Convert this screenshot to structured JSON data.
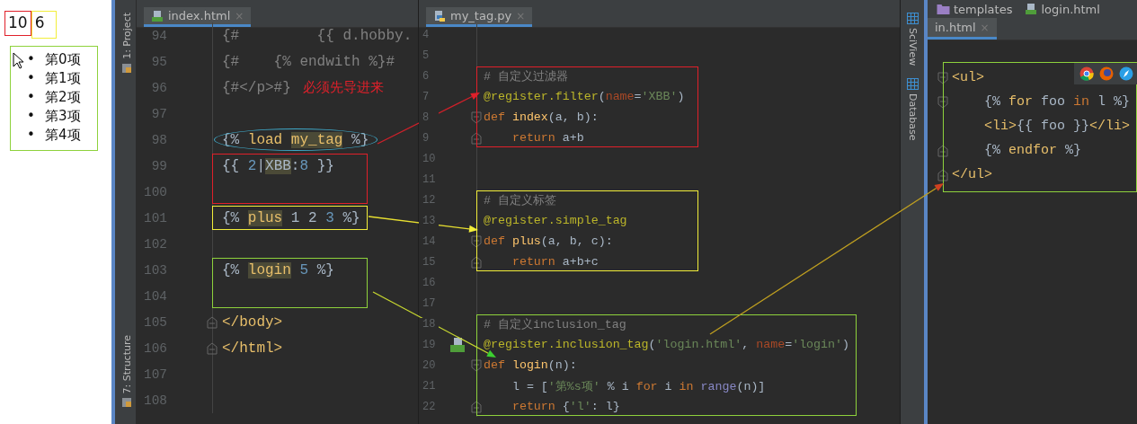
{
  "preview": {
    "numbers": [
      {
        "text": "10",
        "color": "#e0202a"
      },
      {
        "text": "6",
        "color": "#f2ee3a"
      }
    ],
    "list": {
      "color": "#8ed23c",
      "items": [
        {
          "bullet": "•",
          "text": "第0项"
        },
        {
          "bullet": "•",
          "text": "第1项"
        },
        {
          "bullet": "•",
          "text": "第2项"
        },
        {
          "bullet": "•",
          "text": "第3项"
        },
        {
          "bullet": "•",
          "text": "第4项"
        }
      ]
    }
  },
  "left_toolbar": [
    {
      "label": "1: Project"
    },
    {
      "label": "7: Structure"
    }
  ],
  "editors": [
    {
      "tab": {
        "label": "index.html",
        "close": "×",
        "selected": true,
        "kind": "html"
      },
      "blocks": [
        {
          "lines": [
            {
              "number": "94",
              "kind": "plain",
              "tokens": [
                {
                  "text": "{#         {{ d.hobby.",
                  "kind": "comment"
                }
              ]
            },
            {
              "number": "95",
              "kind": "plain",
              "tokens": [
                {
                  "text": "{#    {% endwith %}#",
                  "kind": "comment"
                }
              ]
            },
            {
              "number": "96",
              "kind": "plain",
              "tokens": [
                {
                  "text": "{#</p>#}",
                  "kind": "comment"
                }
              ],
              "note": "必须先导进来"
            },
            {
              "number": "97",
              "kind": "plain"
            }
          ]
        },
        {
          "frame": {
            "kind": "ellipse",
            "color": "#3fa9c9"
          },
          "lines": [
            {
              "number": "98",
              "kind": "plain",
              "tokens": [
                {
                  "text": "{% ",
                  "kind": "plain"
                },
                {
                  "text": "load ",
                  "kind": "directive"
                },
                {
                  "text": "my_tag",
                  "kind": "directive",
                  "highlight": true
                },
                {
                  "text": " %}",
                  "kind": "plain"
                }
              ]
            }
          ]
        },
        {
          "frame": {
            "kind": "rect",
            "color": "#e0202a"
          },
          "lines": [
            {
              "number": "99",
              "kind": "plain",
              "tokens": [
                {
                  "text": "{{ ",
                  "kind": "plain"
                },
                {
                  "text": "2",
                  "kind": "number"
                },
                {
                  "text": "|",
                  "kind": "plain"
                },
                {
                  "text": "XBB",
                  "kind": "plain",
                  "highlight": true
                },
                {
                  "text": ":",
                  "kind": "plain"
                },
                {
                  "text": "8",
                  "kind": "number"
                },
                {
                  "text": " }}",
                  "kind": "plain"
                }
              ]
            },
            {
              "number": "100",
              "kind": "plain"
            }
          ]
        },
        {
          "frame": {
            "kind": "rect",
            "color": "#f2ee3a"
          },
          "lines": [
            {
              "number": "101",
              "kind": "plain",
              "tokens": [
                {
                  "text": "{% ",
                  "kind": "plain"
                },
                {
                  "text": "plus",
                  "kind": "directive",
                  "highlight": true
                },
                {
                  "text": " 1 2 ",
                  "kind": "plain"
                },
                {
                  "text": "3",
                  "kind": "number"
                },
                {
                  "text": " %}",
                  "kind": "plain"
                }
              ]
            }
          ]
        },
        {
          "lines": [
            {
              "number": "102",
              "kind": "plain"
            }
          ]
        },
        {
          "frame": {
            "kind": "rect",
            "color": "#8ed23c"
          },
          "lines": [
            {
              "number": "103",
              "kind": "plain",
              "tokens": [
                {
                  "text": "{% ",
                  "kind": "plain"
                },
                {
                  "text": "login",
                  "kind": "directive",
                  "highlight": true
                },
                {
                  "text": " 5",
                  "kind": "number"
                },
                {
                  "text": " %}",
                  "kind": "plain"
                }
              ]
            },
            {
              "number": "104",
              "kind": "plain"
            }
          ]
        },
        {
          "lines": [
            {
              "number": "105",
              "kind": "fold-end",
              "tokens": [
                {
                  "text": "</body>",
                  "kind": "tag"
                }
              ]
            },
            {
              "number": "106",
              "kind": "fold-end",
              "tokens": [
                {
                  "text": "</html>",
                  "kind": "tag"
                }
              ]
            },
            {
              "number": "107",
              "kind": "plain"
            },
            {
              "number": "108",
              "kind": "plain"
            }
          ]
        }
      ]
    },
    {
      "tab": {
        "label": "my_tag.py",
        "close": "×",
        "selected": true,
        "kind": "python"
      },
      "blocks": [
        {
          "lines": [
            {
              "number": "4",
              "kind": "plain"
            },
            {
              "number": "5",
              "kind": "plain"
            }
          ]
        },
        {
          "frame": {
            "kind": "rect",
            "color": "#e0202a"
          },
          "lines": [
            {
              "number": "6",
              "kind": "plain",
              "tokens": [
                {
                  "text": "# 自定义过滤器",
                  "kind": "comment"
                }
              ]
            },
            {
              "number": "7",
              "kind": "plain",
              "tokens": [
                {
                  "text": "@register.filter",
                  "kind": "decorator"
                },
                {
                  "text": "(",
                  "kind": "plain"
                },
                {
                  "text": "name",
                  "kind": "param"
                },
                {
                  "text": "=",
                  "kind": "plain"
                },
                {
                  "text": "'XBB'",
                  "kind": "string"
                },
                {
                  "text": ")",
                  "kind": "plain"
                }
              ]
            },
            {
              "number": "8",
              "kind": "fold-start",
              "tokens": [
                {
                  "text": "def ",
                  "kind": "keyword"
                },
                {
                  "text": "index",
                  "kind": "function"
                },
                {
                  "text": "(a, b):",
                  "kind": "plain"
                }
              ]
            },
            {
              "number": "9",
              "kind": "fold-end",
              "tokens": [
                {
                  "text": "    return",
                  "kind": "keyword"
                },
                {
                  "text": " a+b",
                  "kind": "plain"
                }
              ]
            }
          ]
        },
        {
          "lines": [
            {
              "number": "10",
              "kind": "plain"
            },
            {
              "number": "11",
              "kind": "plain"
            }
          ]
        },
        {
          "frame": {
            "kind": "rect",
            "color": "#f2ee3a"
          },
          "lines": [
            {
              "number": "12",
              "kind": "plain",
              "tokens": [
                {
                  "text": "# 自定义标签",
                  "kind": "comment"
                }
              ]
            },
            {
              "number": "13",
              "kind": "plain",
              "tokens": [
                {
                  "text": "@register.simple_tag",
                  "kind": "decorator"
                }
              ]
            },
            {
              "number": "14",
              "kind": "fold-start",
              "tokens": [
                {
                  "text": "def ",
                  "kind": "keyword"
                },
                {
                  "text": "plus",
                  "kind": "function"
                },
                {
                  "text": "(a, b, c):",
                  "kind": "plain"
                }
              ]
            },
            {
              "number": "15",
              "kind": "fold-end",
              "tokens": [
                {
                  "text": "    return",
                  "kind": "keyword"
                },
                {
                  "text": " a+b+c",
                  "kind": "plain"
                }
              ]
            }
          ]
        },
        {
          "lines": [
            {
              "number": "16",
              "kind": "plain"
            },
            {
              "number": "17",
              "kind": "plain"
            }
          ]
        },
        {
          "frame": {
            "kind": "rect",
            "color": "#8ed23c"
          },
          "lines": [
            {
              "number": "18",
              "kind": "plain",
              "tokens": [
                {
                  "text": "# 自定义inclusion_tag",
                  "kind": "comment"
                }
              ]
            },
            {
              "number": "19",
              "kind": "linked",
              "tokens": [
                {
                  "text": "@register.inclusion_tag",
                  "kind": "decorator"
                },
                {
                  "text": "(",
                  "kind": "plain"
                },
                {
                  "text": "'login.html'",
                  "kind": "string"
                },
                {
                  "text": ", ",
                  "kind": "plain"
                },
                {
                  "text": "name",
                  "kind": "param"
                },
                {
                  "text": "=",
                  "kind": "plain"
                },
                {
                  "text": "'login'",
                  "kind": "string"
                },
                {
                  "text": ")",
                  "kind": "plain"
                }
              ]
            },
            {
              "number": "20",
              "kind": "fold-start",
              "tokens": [
                {
                  "text": "def ",
                  "kind": "keyword"
                },
                {
                  "text": "login",
                  "kind": "function"
                },
                {
                  "text": "(n):",
                  "kind": "plain"
                }
              ]
            },
            {
              "number": "21",
              "kind": "plain",
              "tokens": [
                {
                  "text": "    l = [",
                  "kind": "plain"
                },
                {
                  "text": "'第%s项'",
                  "kind": "string"
                },
                {
                  "text": " % i ",
                  "kind": "plain"
                },
                {
                  "text": "for",
                  "kind": "keyword"
                },
                {
                  "text": " i ",
                  "kind": "plain"
                },
                {
                  "text": "in ",
                  "kind": "keyword"
                },
                {
                  "text": "range",
                  "kind": "builtin"
                },
                {
                  "text": "(n)]",
                  "kind": "plain"
                }
              ]
            },
            {
              "number": "22",
              "kind": "fold-end",
              "tokens": [
                {
                  "text": "    return",
                  "kind": "keyword"
                },
                {
                  "text": " {",
                  "kind": "plain"
                },
                {
                  "text": "'l'",
                  "kind": "string"
                },
                {
                  "text": ": l}",
                  "kind": "plain"
                }
              ]
            }
          ]
        }
      ]
    },
    {
      "breadcrumb": [
        {
          "label": "templates",
          "kind": "folder"
        },
        {
          "label": "login.html",
          "kind": "html"
        }
      ],
      "tab": {
        "label": "in.html",
        "close": "×",
        "selected": true,
        "kind": "none"
      },
      "blocks": [
        {
          "frame": {
            "kind": "rect",
            "color": "#8ed23c"
          },
          "lines": [
            {
              "kind": "fold-start",
              "tokens": [
                {
                  "text": "<ul>",
                  "kind": "tag"
                }
              ]
            },
            {
              "kind": "fold-start",
              "tokens": [
                {
                  "text": "    {% ",
                  "kind": "plain"
                },
                {
                  "text": "for",
                  "kind": "directive"
                },
                {
                  "text": " foo ",
                  "kind": "plain"
                },
                {
                  "text": "in",
                  "kind": "keyword"
                },
                {
                  "text": " l %}",
                  "kind": "plain"
                }
              ]
            },
            {
              "kind": "plain",
              "tokens": [
                {
                  "text": "    <li>",
                  "kind": "tag"
                },
                {
                  "text": "{{ foo }}",
                  "kind": "plain"
                },
                {
                  "text": "</li>",
                  "kind": "tag"
                }
              ]
            },
            {
              "kind": "fold-end",
              "tokens": [
                {
                  "text": "    {% ",
                  "kind": "plain"
                },
                {
                  "text": "endfor",
                  "kind": "directive"
                },
                {
                  "text": " %}",
                  "kind": "plain"
                }
              ]
            },
            {
              "kind": "fold-end",
              "tokens": [
                {
                  "text": "</ul>",
                  "kind": "tag"
                }
              ]
            }
          ]
        }
      ]
    }
  ],
  "right_toolbar": [
    {
      "label": "SciView"
    },
    {
      "label": "Database"
    }
  ]
}
